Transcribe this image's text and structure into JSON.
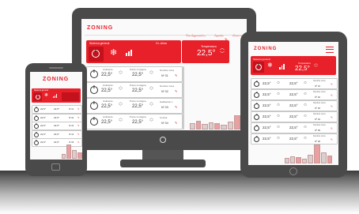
{
  "brand": {
    "logo": "ZONING"
  },
  "desktop": {
    "nav": [
      "Configuración",
      "Ayuda",
      "Ahorro"
    ],
    "master": {
      "label": "Sistema general",
      "mode": "Gr. clima",
      "temp_label": "Temperatura",
      "temp_value": "22,5°"
    },
    "zones": [
      {
        "temp_label": "Ambiente",
        "temp_value": "22,5°",
        "set_label": "Punto consigna",
        "set_value": "22,5°",
        "name_label": "Nombre zona",
        "name_value": "Nº 01"
      },
      {
        "temp_label": "Ambiente",
        "temp_value": "22,5°",
        "set_label": "Punto consigna",
        "set_value": "22,5°",
        "name_label": "Nombre zona",
        "name_value": "Nº 02"
      },
      {
        "temp_label": "Ambiente",
        "temp_value": "22,5°",
        "set_label": "Punto consigna",
        "set_value": "22,5°",
        "name_label": "Habitación 1",
        "name_value": "Nº 03"
      },
      {
        "temp_label": "Ambiente",
        "temp_value": "22,5°",
        "set_label": "Punto consigna",
        "set_value": "22,5°",
        "name_label": "Cocina",
        "name_value": "Nº 04"
      }
    ]
  },
  "tablet": {
    "master": {
      "label": "Sistema general",
      "temp_label": "Temperatura",
      "temp_value": "22,5°"
    },
    "zones": [
      {
        "temp_value": "22,5°",
        "set_value": "22,5°",
        "name_label": "Nombre zona",
        "name_value": "Nº 01"
      },
      {
        "temp_value": "22,5°",
        "set_value": "22,5°",
        "name_label": "Nombre zona",
        "name_value": "Nº 02"
      },
      {
        "temp_value": "22,5°",
        "set_value": "22,5°",
        "name_label": "Nombre zona",
        "name_value": "Nº 03"
      },
      {
        "temp_value": "22,5°",
        "set_value": "22,5°",
        "name_label": "Nombre zona",
        "name_value": "Nº 04"
      },
      {
        "temp_value": "22,5°",
        "set_value": "22,5°",
        "name_label": "Nombre zona",
        "name_value": "Nº 05"
      },
      {
        "temp_value": "22,5°",
        "set_value": "22,5°",
        "name_label": "Nombre zona",
        "name_value": "Nº 06"
      }
    ]
  },
  "phone": {
    "master": {
      "label": "Sistema general"
    },
    "zones": [
      {
        "temp_value": "22,5°",
        "set_value": "22,5°",
        "name_value": "Nº 01"
      },
      {
        "temp_value": "22,5°",
        "set_value": "22,5°",
        "name_value": "Nº 02"
      },
      {
        "temp_value": "22,5°",
        "set_value": "22,5°",
        "name_value": "Nº 03"
      },
      {
        "temp_value": "22,5°",
        "set_value": "22,5°",
        "name_value": "Nº 04"
      },
      {
        "temp_value": "22,5°",
        "set_value": "22,5°",
        "name_value": "Nº 05"
      }
    ]
  },
  "colors": {
    "accent": "#e8202a",
    "bezel": "#4a4a4a",
    "screen": "#fafafa"
  }
}
